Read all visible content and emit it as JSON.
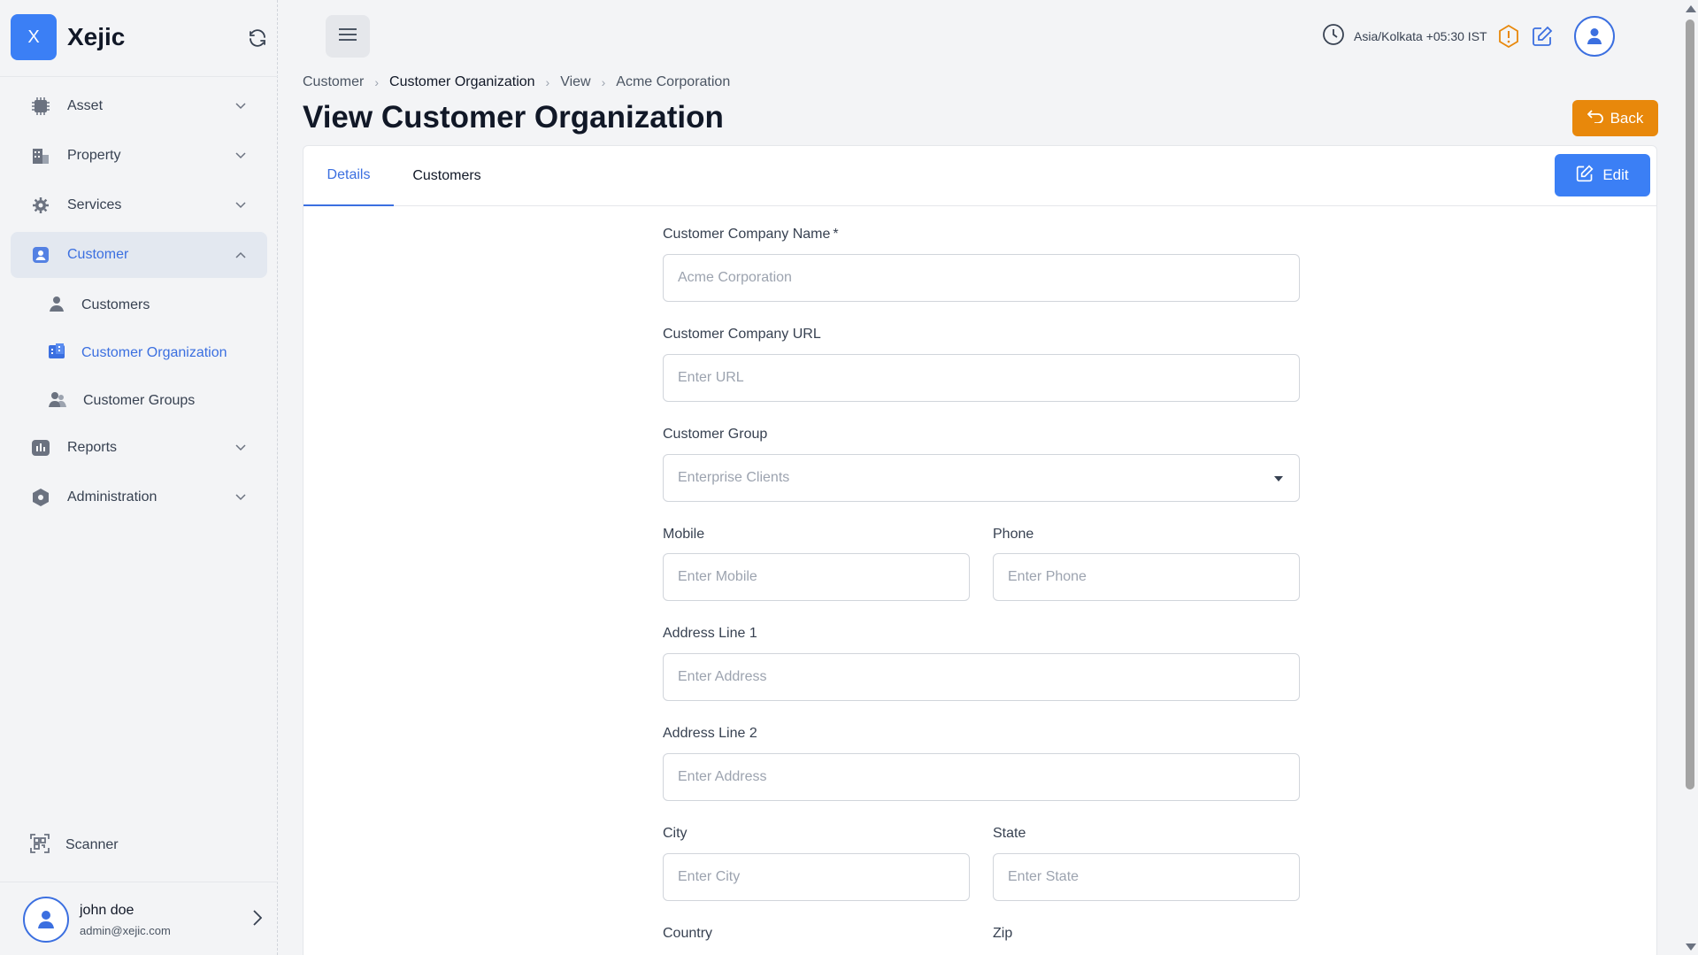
{
  "brand": {
    "logo_letter": "X",
    "name": "Xejic"
  },
  "sidebar": {
    "items": [
      {
        "label": "Asset",
        "icon": "chip-icon"
      },
      {
        "label": "Property",
        "icon": "building-icon"
      },
      {
        "label": "Services",
        "icon": "gear-icon"
      },
      {
        "label": "Customer",
        "icon": "customer-icon",
        "expanded": true
      },
      {
        "label": "Reports",
        "icon": "reports-icon"
      },
      {
        "label": "Administration",
        "icon": "hexagon-icon"
      }
    ],
    "customer_sub": [
      {
        "label": "Customers",
        "icon": "person-icon"
      },
      {
        "label": "Customer Organization",
        "icon": "organization-icon",
        "active": true
      },
      {
        "label": "Customer Groups",
        "icon": "group-icon"
      }
    ],
    "scanner": {
      "label": "Scanner",
      "icon": "scanner-icon"
    },
    "user": {
      "name": "john doe",
      "email": "admin@xejic.com"
    }
  },
  "topbar": {
    "timezone": "Asia/Kolkata +05:30 IST"
  },
  "breadcrumb": [
    "Customer",
    "Customer Organization",
    "View",
    "Acme Corporation"
  ],
  "page": {
    "title": "View Customer Organization",
    "back_label": "Back",
    "edit_label": "Edit"
  },
  "tabs": [
    "Details",
    "Customers"
  ],
  "form": {
    "company_name": {
      "label": "Customer Company Name",
      "required_mark": "*",
      "value": "Acme Corporation"
    },
    "company_url": {
      "label": "Customer Company URL",
      "placeholder": "Enter URL"
    },
    "customer_group": {
      "label": "Customer Group",
      "value": "Enterprise Clients"
    },
    "mobile": {
      "label": "Mobile",
      "placeholder": "Enter Mobile"
    },
    "phone": {
      "label": "Phone",
      "placeholder": "Enter Phone"
    },
    "address1": {
      "label": "Address Line 1",
      "placeholder": "Enter Address"
    },
    "address2": {
      "label": "Address Line 2",
      "placeholder": "Enter Address"
    },
    "city": {
      "label": "City",
      "placeholder": "Enter City"
    },
    "state": {
      "label": "State",
      "placeholder": "Enter State"
    },
    "country": {
      "label": "Country"
    },
    "zip": {
      "label": "Zip"
    }
  },
  "colors": {
    "primary": "#3b7ff5",
    "active_text": "#3b6fe0",
    "back_button": "#e8880b",
    "warning": "#e8880b"
  }
}
